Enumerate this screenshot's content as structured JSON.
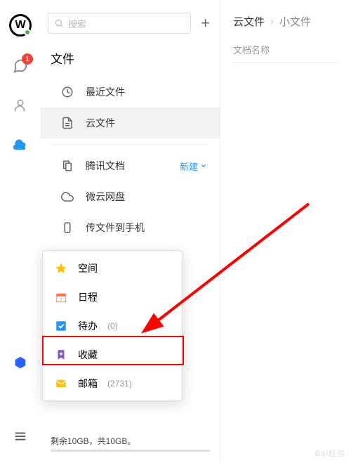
{
  "search": {
    "placeholder": "搜索"
  },
  "sidebar": {
    "badge": "1"
  },
  "mid": {
    "title": "文件",
    "items": {
      "recent": "最近文件",
      "cloud": "云文件",
      "tencent": "腾讯文档",
      "tencent_new": "新建",
      "weiyun": "微云网盘",
      "tophone": "传文件到手机"
    },
    "storage_text": "剩余10GB，共10GB。"
  },
  "popup": {
    "space": "空间",
    "calendar": "日程",
    "todo": "待办",
    "todo_count": "(0)",
    "favorites": "收藏",
    "mail": "邮箱",
    "mail_count": "(2731)"
  },
  "right": {
    "bc1": "云文件",
    "bc2": "小文件",
    "col": "文档名称"
  },
  "watermark": "Bai经验"
}
